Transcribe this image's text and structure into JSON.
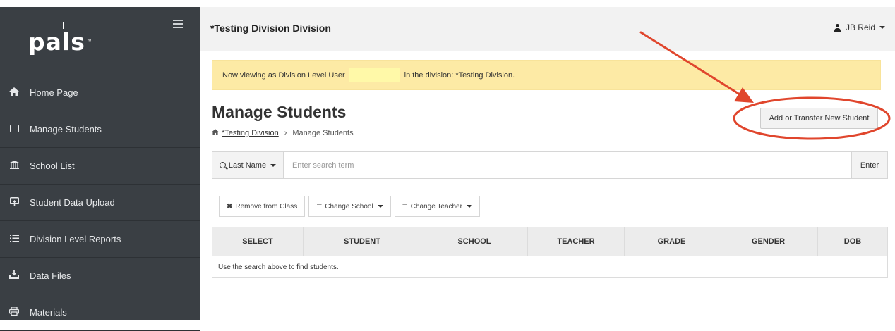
{
  "sidebar": {
    "logo": "pals",
    "logo_tm": "™",
    "items": [
      {
        "label": "Home Page",
        "icon": "home-icon"
      },
      {
        "label": "Manage Students",
        "icon": "id-card-icon"
      },
      {
        "label": "School List",
        "icon": "building-columns-icon"
      },
      {
        "label": "Student Data Upload",
        "icon": "upload-icon"
      },
      {
        "label": "Division Level Reports",
        "icon": "list-icon"
      },
      {
        "label": "Data Files",
        "icon": "download-icon"
      },
      {
        "label": "Materials",
        "icon": "printer-icon"
      }
    ]
  },
  "header": {
    "title": "*Testing Division Division",
    "user": "JB Reid"
  },
  "alert": {
    "prefix": "Now viewing as Division Level User",
    "suffix": "in the division: *Testing Division."
  },
  "page": {
    "title": "Manage Students",
    "breadcrumb_home": "*Testing Division",
    "breadcrumb_sep": "›",
    "breadcrumb_current": "Manage Students",
    "add_button": "Add or Transfer New Student"
  },
  "search": {
    "field_label": "Last Name",
    "placeholder": "Enter search term",
    "enter_label": "Enter"
  },
  "actions": {
    "remove": "Remove from Class",
    "change_school": "Change School",
    "change_teacher": "Change Teacher"
  },
  "table": {
    "columns": [
      "SELECT",
      "STUDENT",
      "SCHOOL",
      "TEACHER",
      "GRADE",
      "GENDER",
      "DOB"
    ],
    "empty_message": "Use the search above to find students."
  },
  "colors": {
    "sidebar_bg": "#3a3f44",
    "alert_bg": "#fdeaa5",
    "annotation_red": "#e0462d"
  }
}
